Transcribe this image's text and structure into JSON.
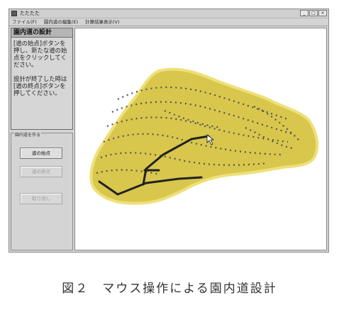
{
  "window": {
    "title": "たたたた",
    "buttons": [
      "_",
      "□",
      "×"
    ]
  },
  "menu": [
    "ファイル(F)",
    "園内道の編集(E)",
    "計算結果表示(V)"
  ],
  "side": {
    "header": "園内道の設計",
    "instructions": [
      "[道の始点]ボタンを押し、新たな道の始点をクリックしてください。",
      "設計が終了した時は[道の終点]ボタンを押してください。"
    ],
    "group_title": "園内道を作る",
    "buttons": [
      {
        "label": "道の始点",
        "enabled": true
      },
      {
        "label": "道の終点",
        "enabled": false
      },
      {
        "label": "取り消し",
        "enabled": false
      }
    ]
  },
  "colors": {
    "field_fill": "#d8c74c",
    "field_edge": "#eee07a",
    "road": "#222222"
  },
  "caption": "図２　マウス操作による園内道設計"
}
